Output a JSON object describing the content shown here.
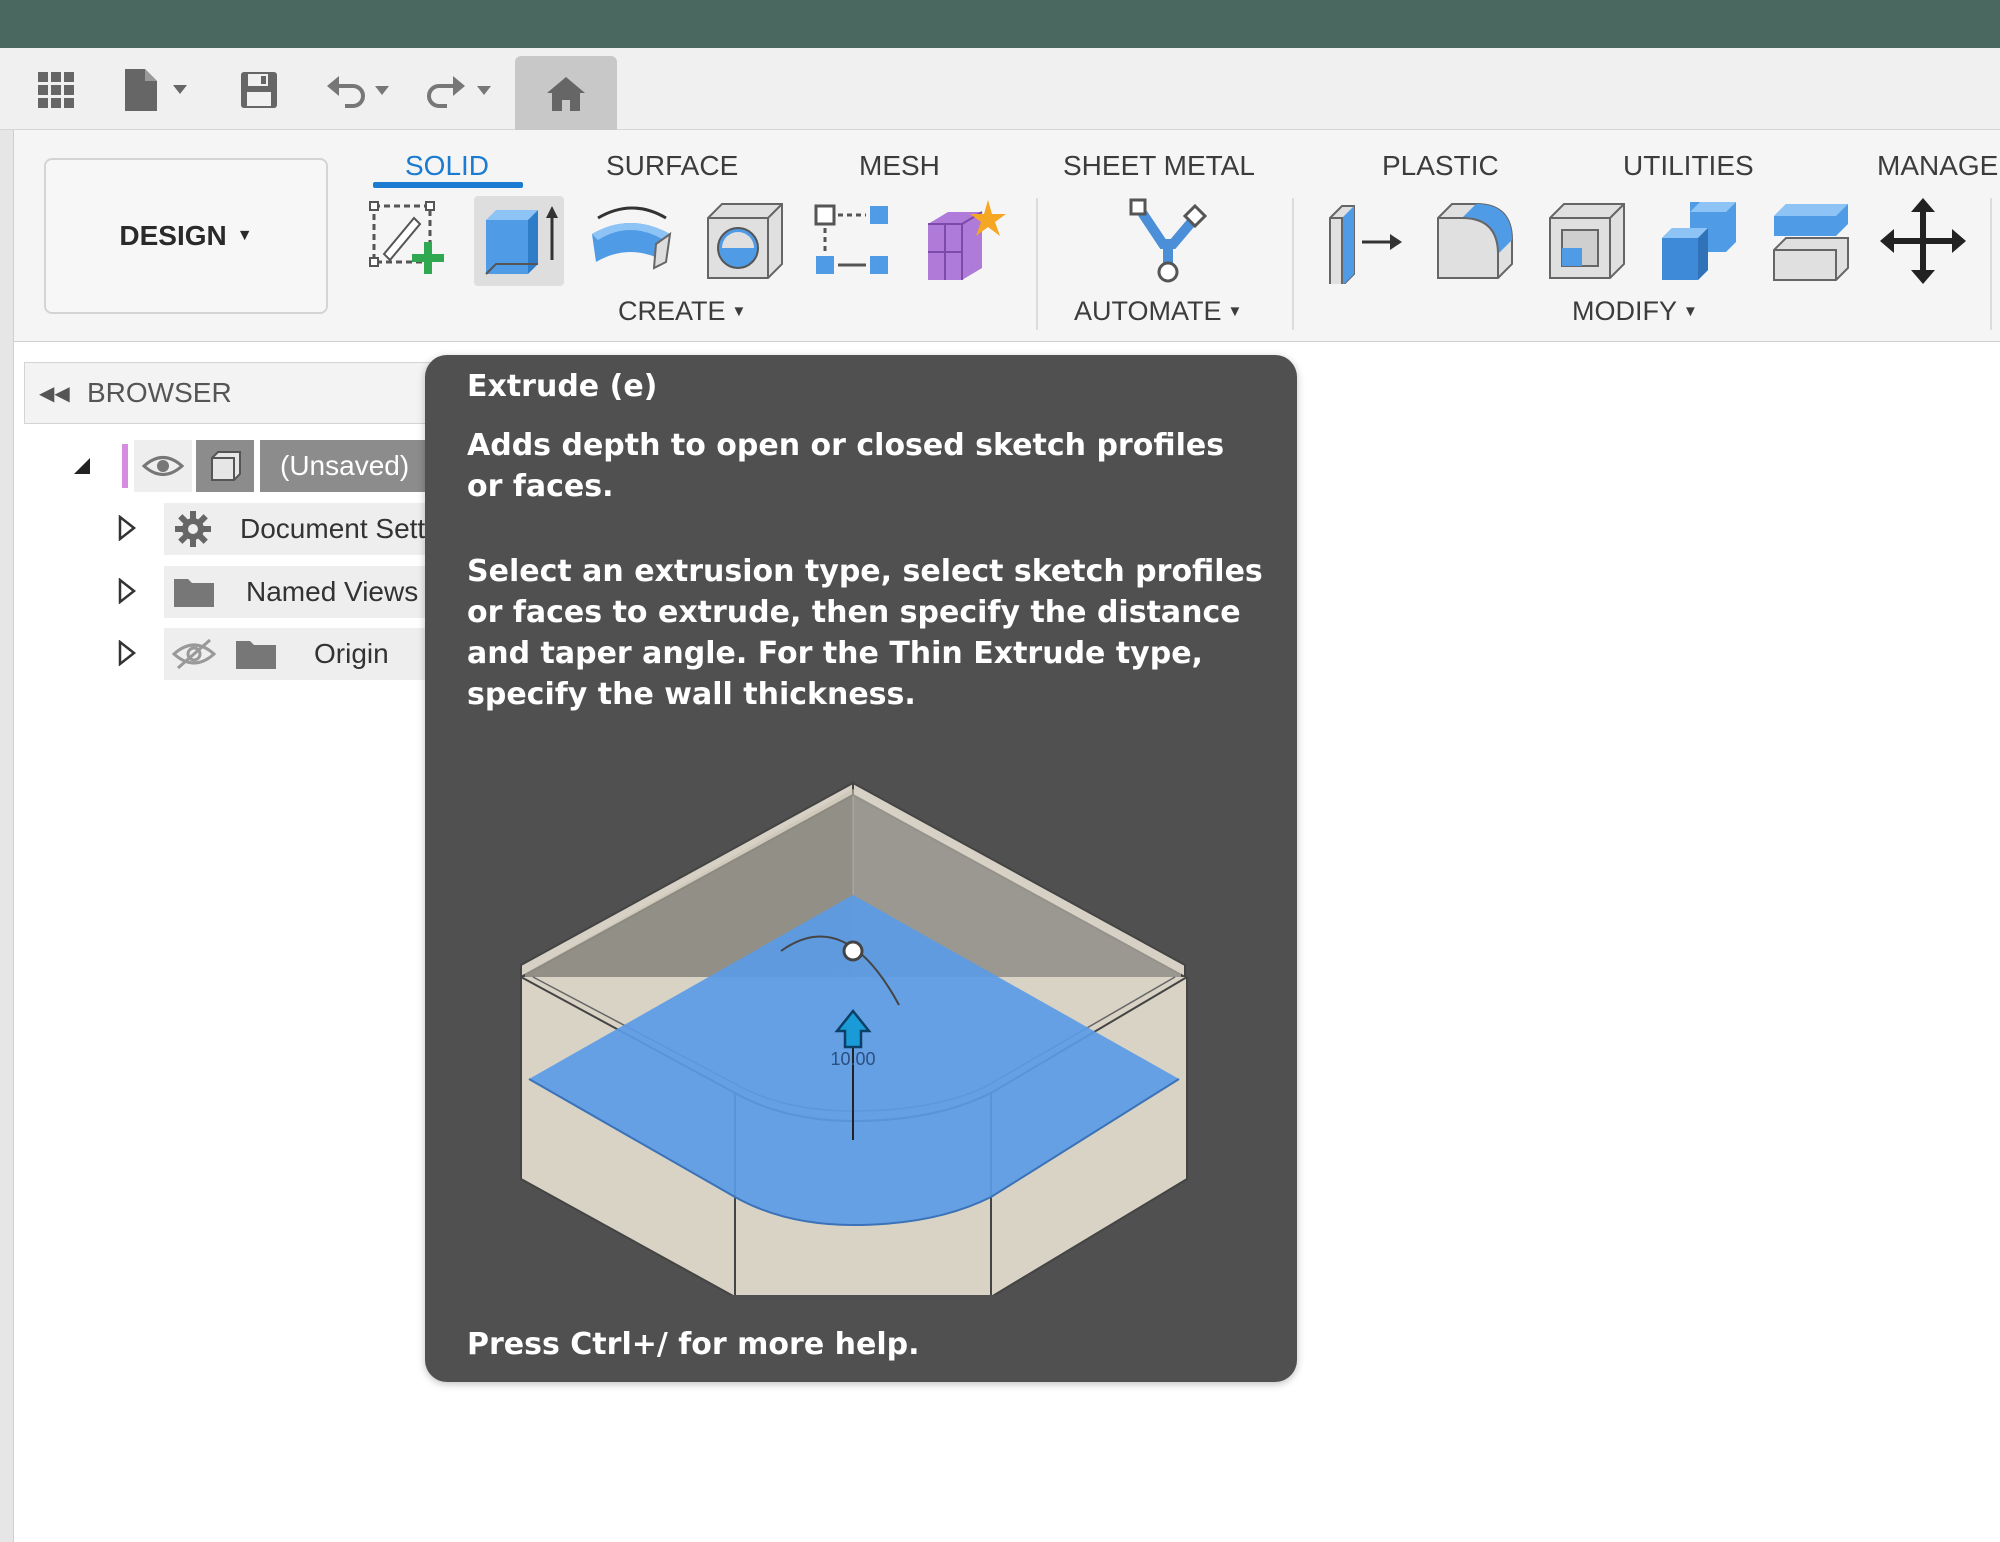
{
  "workspace": {
    "label": "DESIGN"
  },
  "tabs": [
    {
      "label": "SOLID",
      "active": true
    },
    {
      "label": "SURFACE"
    },
    {
      "label": "MESH"
    },
    {
      "label": "SHEET METAL"
    },
    {
      "label": "PLASTIC"
    },
    {
      "label": "UTILITIES"
    },
    {
      "label": "MANAGE"
    }
  ],
  "groups": {
    "create": "CREATE",
    "automate": "AUTOMATE",
    "modify": "MODIFY"
  },
  "browser": {
    "title": "BROWSER",
    "root_label": "(Unsaved)",
    "items": [
      {
        "label": "Document Sett"
      },
      {
        "label": "Named Views"
      },
      {
        "label": "Origin"
      }
    ]
  },
  "tooltip": {
    "title": "Extrude (e)",
    "description": "Adds depth to open or closed sketch profiles or faces.",
    "detail": "Select an extrusion type, select sketch profiles or faces to extrude, then specify the distance and taper angle. For the Thin Extrude type, specify the wall thickness.",
    "dimension_label": "10.00",
    "footer": "Press Ctrl+/ for more help."
  },
  "colors": {
    "title_bar": "#4a6860",
    "accent": "#1a7bd0",
    "tooltip_bg": "#505050",
    "profile_blue": "#5b9be6"
  }
}
